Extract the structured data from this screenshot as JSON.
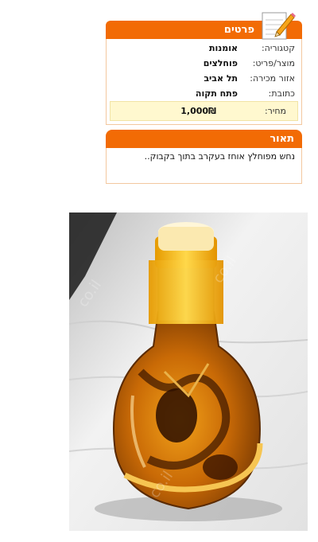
{
  "details": {
    "title": "פרטים",
    "rows": [
      {
        "label": "קטגוריה:",
        "value": "אומנות"
      },
      {
        "label": "מוצר/פריט:",
        "value": "פוחלצים"
      },
      {
        "label": "אזור מכירה:",
        "value": "תל אביב"
      },
      {
        "label": "כתובת:",
        "value": "פתח תקוה"
      }
    ],
    "price_label": "מחיר:",
    "price_value": "1,000",
    "currency": "₪"
  },
  "description": {
    "title": "תאור",
    "text": "נחש מפוחלץ אוחז בעקרב בתוך בקבוק.."
  },
  "photo": {
    "watermark": "co.il"
  },
  "colors": {
    "header_orange": "#f26b05",
    "price_bg": "#fff8cf",
    "border": "#f3c89f"
  }
}
